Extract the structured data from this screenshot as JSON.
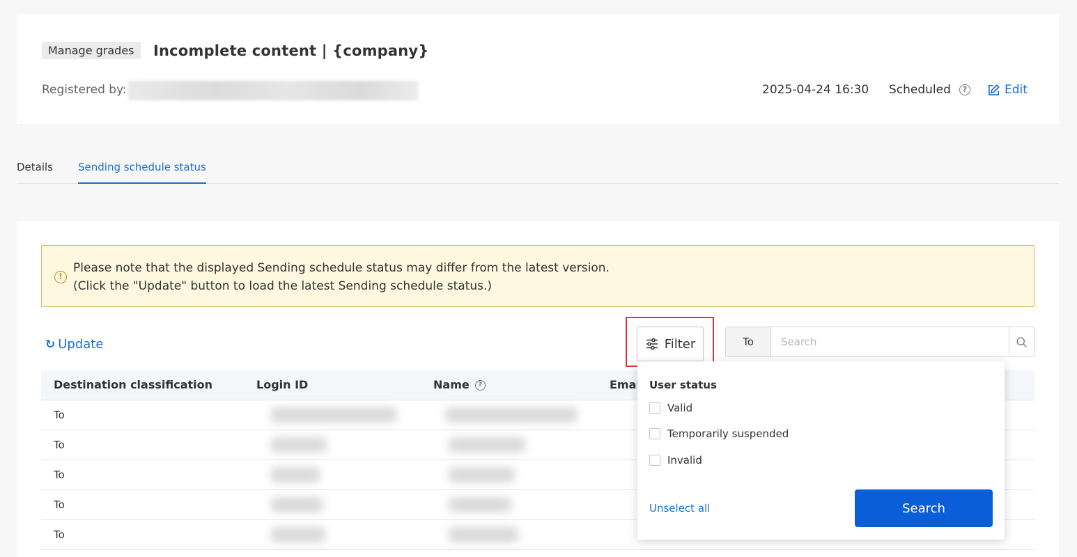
{
  "header": {
    "badge": "Manage grades",
    "title": "Incomplete content | {company}",
    "registered_label": "Registered by:",
    "datetime": "2025-04-24 16:30",
    "status": "Scheduled",
    "status_help": "?",
    "edit_label": "Edit"
  },
  "tabs": [
    {
      "label": "Details",
      "active": false
    },
    {
      "label": "Sending schedule status",
      "active": true
    }
  ],
  "notice": {
    "line1": "Please note that the displayed Sending schedule status may differ from the latest version.",
    "line2": "(Click the \"Update\" button to load the latest Sending schedule status.)"
  },
  "toolbar": {
    "update_label": "Update",
    "filter_label": "Filter",
    "scope_value": "To",
    "search_placeholder": "Search"
  },
  "table": {
    "columns": [
      "Destination classification",
      "Login ID",
      "Name",
      "Emai"
    ],
    "rows": [
      {
        "destination": "To"
      },
      {
        "destination": "To"
      },
      {
        "destination": "To"
      },
      {
        "destination": "To"
      },
      {
        "destination": "To"
      }
    ]
  },
  "filter_dropdown": {
    "title": "User status",
    "options": [
      "Valid",
      "Temporarily suspended",
      "Invalid"
    ],
    "unselect_label": "Unselect all",
    "search_label": "Search"
  },
  "colors": {
    "accent": "#1a6fd8",
    "primary_button": "#0a5ed7",
    "notice_bg": "#fdf8df",
    "notice_border": "#d9b86a",
    "highlight": "#e0343a"
  },
  "icons": [
    "help-icon",
    "edit-icon",
    "warning-icon",
    "refresh-icon",
    "filter-sliders-icon",
    "search-icon"
  ]
}
